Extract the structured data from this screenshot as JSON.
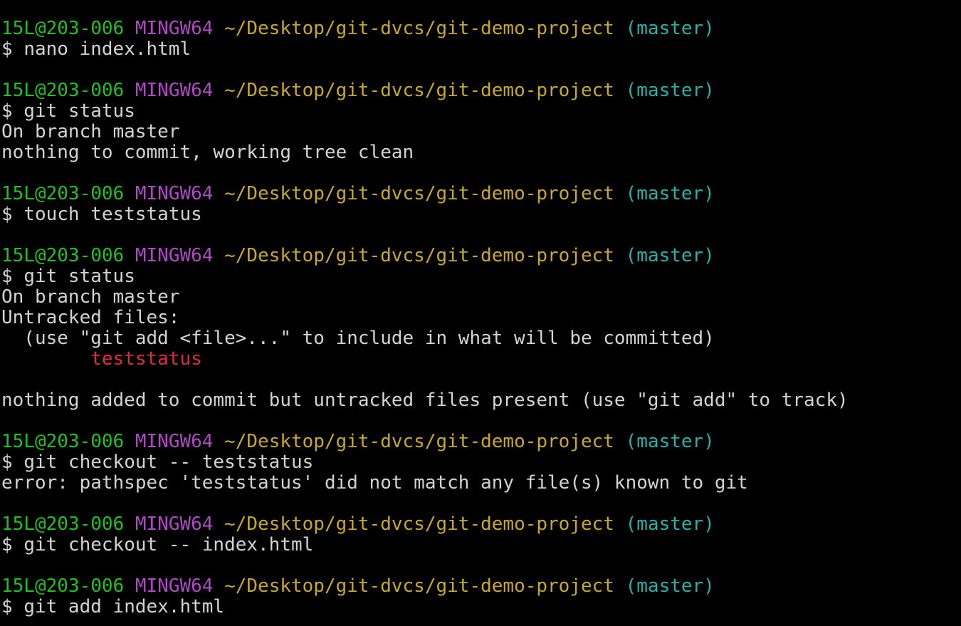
{
  "prompt": {
    "user_host": "15L@203-006",
    "system": "MINGW64",
    "path": "~/Desktop/git-dvcs/git-demo-project",
    "branch": "(master)",
    "symbol": "$"
  },
  "blocks": [
    {
      "command": "nano index.html",
      "output": []
    },
    {
      "command": "git status",
      "output": [
        {
          "text": "On branch master",
          "style": "out"
        },
        {
          "text": "nothing to commit, working tree clean",
          "style": "out"
        }
      ]
    },
    {
      "command": "touch teststatus",
      "output": []
    },
    {
      "command": "git status",
      "output": [
        {
          "text": "On branch master",
          "style": "out"
        },
        {
          "text": "Untracked files:",
          "style": "out"
        },
        {
          "text": "  (use \"git add <file>...\" to include in what will be committed)",
          "style": "out"
        },
        {
          "text": "        teststatus",
          "style": "err-file"
        },
        {
          "text": "",
          "style": "out"
        },
        {
          "text": "nothing added to commit but untracked files present (use \"git add\" to track)",
          "style": "out"
        }
      ]
    },
    {
      "command": "git checkout -- teststatus",
      "output": [
        {
          "text": "error: pathspec 'teststatus' did not match any file(s) known to git",
          "style": "out"
        }
      ]
    },
    {
      "command": "git checkout -- index.html",
      "output": []
    },
    {
      "command": "git add index.html",
      "output": []
    }
  ],
  "colors": {
    "background": "#000000",
    "user": "#1ec21e",
    "system": "#b148c6",
    "path": "#c8a82a",
    "branch": "#24b2a8",
    "text": "#d3d3d3",
    "untracked": "#e02b38"
  }
}
